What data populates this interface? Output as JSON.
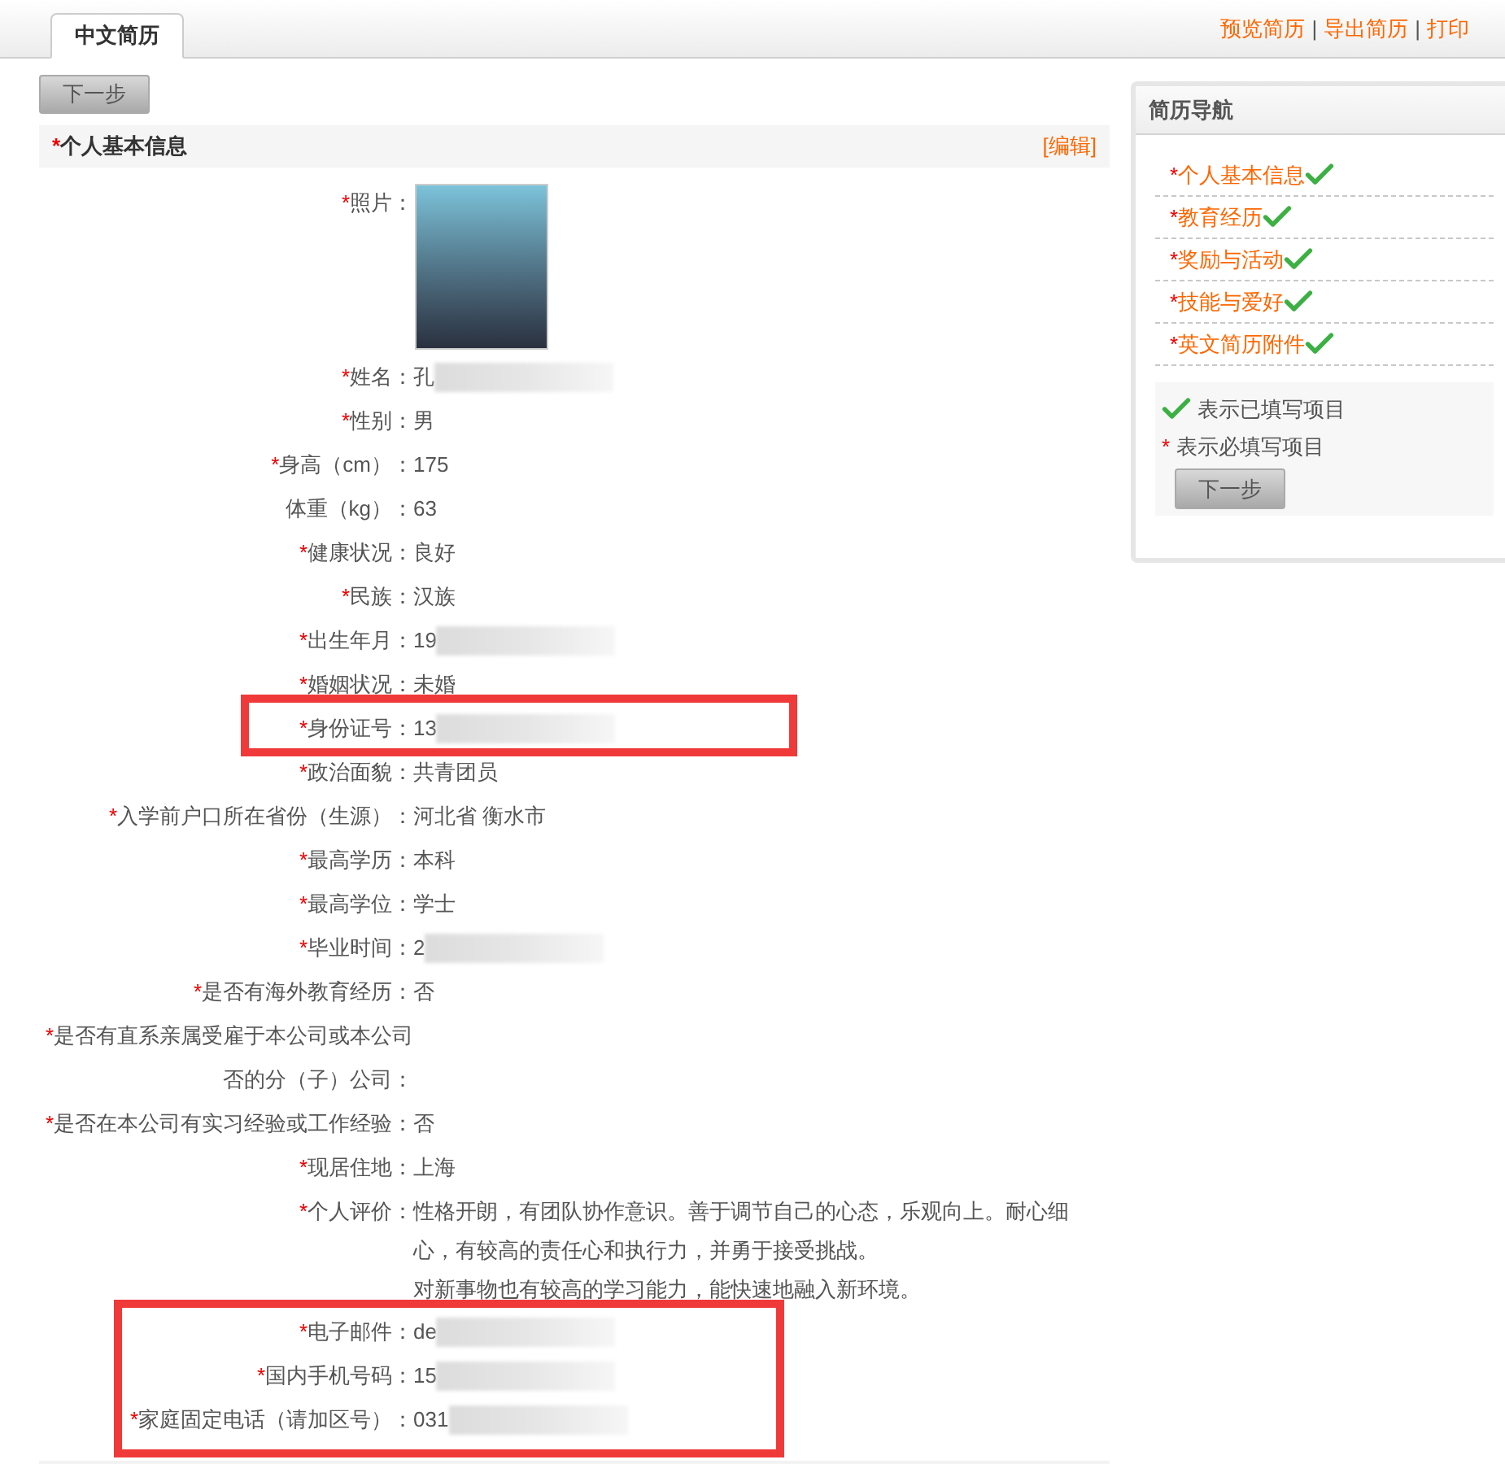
{
  "tabs": [
    {
      "label": "中文简历",
      "selected": true
    }
  ],
  "header_links": [
    "预览简历",
    "导出简历",
    "打印"
  ],
  "header_separator": "|",
  "next_button": "下一步",
  "section": {
    "mark": "*",
    "title": "个人基本信息",
    "edit": "[编辑]"
  },
  "photo": {
    "mark": "*",
    "label": "照片："
  },
  "fields": [
    {
      "mark": "*",
      "label": "姓名：",
      "value": "孔",
      "redacted": true,
      "framed": false
    },
    {
      "mark": "*",
      "label": "性别：",
      "value": "男",
      "redacted": false,
      "framed": false
    },
    {
      "mark": "*",
      "label": "身高（cm）：",
      "value": "175",
      "redacted": false,
      "framed": false
    },
    {
      "label": "体重（kg）：",
      "value": "63",
      "redacted": false,
      "framed": false
    },
    {
      "mark": "*",
      "label": "健康状况：",
      "value": "良好",
      "redacted": false,
      "framed": false
    },
    {
      "mark": "*",
      "label": "民族：",
      "value": "汉族",
      "redacted": false,
      "framed": false
    },
    {
      "mark": "*",
      "label": "出生年月：",
      "value": "19",
      "redacted": true,
      "framed": false
    },
    {
      "mark": "*",
      "label": "婚姻状况：",
      "value": "未婚",
      "redacted": false,
      "framed": false
    },
    {
      "mark": "*",
      "label": "身份证号：",
      "value": "13",
      "redacted": true,
      "framed": true
    },
    {
      "mark": "*",
      "label": "政治面貌：",
      "value": "共青团员",
      "redacted": false,
      "framed": false
    },
    {
      "mark": "*",
      "label": "入学前户口所在省份（生源）：",
      "value": "河北省 衡水市",
      "redacted": false,
      "framed": false
    },
    {
      "mark": "*",
      "label": "最高学历：",
      "value": "本科",
      "redacted": false,
      "framed": false
    },
    {
      "mark": "*",
      "label": "最高学位：",
      "value": "学士",
      "redacted": false,
      "framed": false
    },
    {
      "mark": "*",
      "label": "毕业时间：",
      "value": "2",
      "redacted": true,
      "framed": false
    },
    {
      "mark": "*",
      "label": "是否有海外教育经历：",
      "value": "否",
      "redacted": false,
      "framed": false
    },
    {
      "mark": "*",
      "label": "是否有直系亲属受雇于本公司或本公司否的分（子）公司：",
      "redacted": false,
      "framed": false
    },
    {
      "mark": "*",
      "label": "是否在本公司有实习经验或工作经验：",
      "value": "否",
      "redacted": false,
      "framed": false
    },
    {
      "mark": "*",
      "label": "现居住地：",
      "value": "上海",
      "redacted": false,
      "framed": false
    },
    {
      "mark": "*",
      "label": "个人评价：",
      "lines": [
        "性格开朗，有团队协作意识。善于调节自己的心态，乐观向上。耐心细心，有较高的责任心和执行力，并勇于接受挑战。",
        "对新事物也有较高的学习能力，能快速地融入新环境。"
      ],
      "redacted": false,
      "framed": false
    },
    {
      "mark": "*",
      "label": "电子邮件：",
      "value": "de",
      "redacted": true,
      "framed": true
    },
    {
      "mark": "*",
      "label": "国内手机号码：",
      "value": "15",
      "redacted": true,
      "framed": true
    },
    {
      "mark": "*",
      "label": "家庭固定电话（请加区号）：",
      "value": "031",
      "redacted": true,
      "framed": true
    }
  ],
  "nav": {
    "title": "简历导航",
    "items": [
      {
        "mark": "*",
        "label": "个人基本信息",
        "done": true
      },
      {
        "mark": "*",
        "label": "教育经历",
        "done": true
      },
      {
        "mark": "*",
        "label": "奖励与活动",
        "done": true
      },
      {
        "mark": "*",
        "label": "技能与爱好",
        "done": true
      },
      {
        "mark": "*",
        "label": "英文简历附件",
        "done": true
      }
    ],
    "legend": [
      {
        "kind": "check",
        "text": "表示已填写项目"
      },
      {
        "kind": "star",
        "symbol": "*",
        "text": "表示必填写项目"
      }
    ],
    "button": "下一步"
  }
}
